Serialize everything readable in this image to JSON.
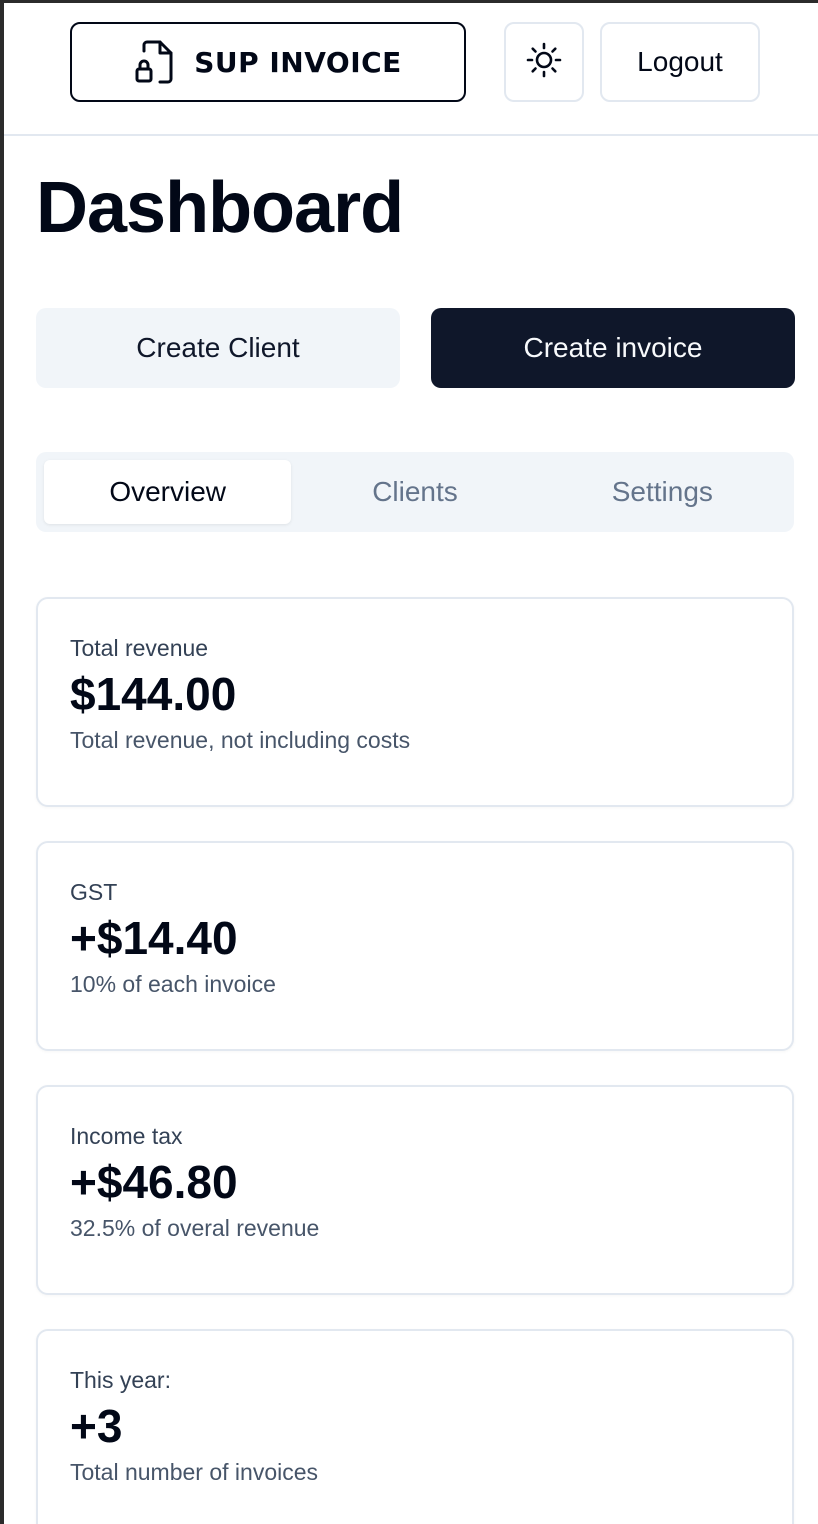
{
  "header": {
    "brand_label": "SUP INVOICE",
    "theme_toggle_icon": "sun-icon",
    "brand_icon": "file-lock-icon",
    "logout_label": "Logout"
  },
  "page": {
    "title": "Dashboard"
  },
  "actions": {
    "create_client_label": "Create Client",
    "create_invoice_label": "Create invoice"
  },
  "tabs": [
    {
      "label": "Overview",
      "active": true
    },
    {
      "label": "Clients",
      "active": false
    },
    {
      "label": "Settings",
      "active": false
    }
  ],
  "cards": [
    {
      "label": "Total revenue",
      "value": "$144.00",
      "description": "Total revenue, not including costs"
    },
    {
      "label": "GST",
      "value": "+$14.40",
      "description": "10% of each invoice"
    },
    {
      "label": "Income tax",
      "value": "+$46.80",
      "description": "32.5% of overal revenue"
    },
    {
      "label": "This year:",
      "value": "+3",
      "description": "Total number of invoices"
    }
  ],
  "colors": {
    "primary": "#0f172a",
    "secondary_bg": "#f1f5f9",
    "border": "#e2e8f0",
    "muted_text": "#64748b"
  }
}
